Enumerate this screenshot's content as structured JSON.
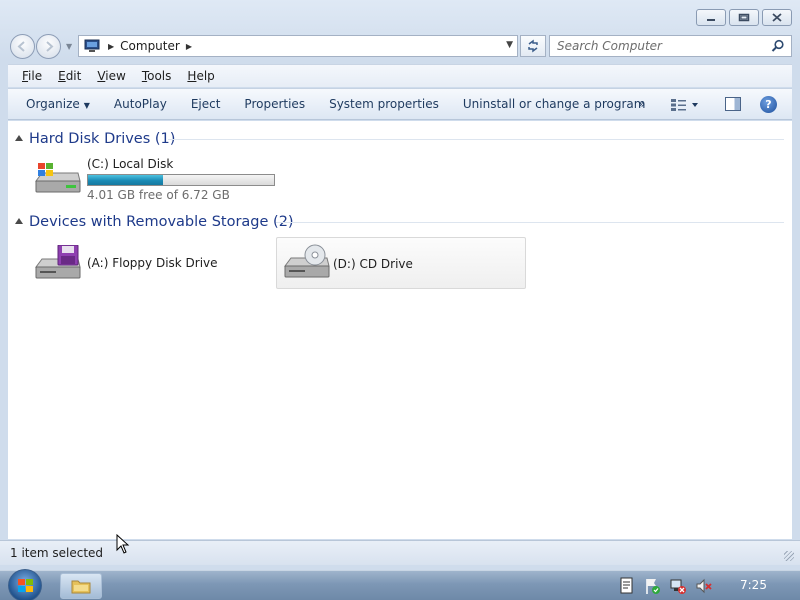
{
  "window": {
    "title_buttons": {
      "minimize_icon": "minimize-icon",
      "maximize_icon": "restore-icon",
      "close_icon": "close-icon"
    }
  },
  "address": {
    "location_icon": "computer-icon",
    "breadcrumb": [
      "Computer"
    ],
    "search_placeholder": "Search Computer"
  },
  "menu": {
    "items": [
      {
        "label": "File",
        "access_key": "F"
      },
      {
        "label": "Edit",
        "access_key": "E"
      },
      {
        "label": "View",
        "access_key": "V"
      },
      {
        "label": "Tools",
        "access_key": "T"
      },
      {
        "label": "Help",
        "access_key": "H"
      }
    ]
  },
  "commands": {
    "organize": "Organize",
    "autoplay": "AutoPlay",
    "eject": "Eject",
    "properties": "Properties",
    "system_properties": "System properties",
    "uninstall": "Uninstall or change a program",
    "more": "»"
  },
  "groups": {
    "hard_disk": {
      "label": "Hard Disk Drives (1)",
      "drives": [
        {
          "name": "(C:) Local Disk",
          "free_text": "4.01 GB free of 6.72 GB",
          "used_fraction": 0.403
        }
      ]
    },
    "removable": {
      "label": "Devices with Removable Storage (2)",
      "drives": [
        {
          "name": "(A:) Floppy Disk Drive"
        },
        {
          "name": "(D:) CD Drive",
          "selected": true
        }
      ]
    }
  },
  "status": {
    "text": "1 item selected"
  },
  "taskbar": {
    "clock": "7:25"
  },
  "colors": {
    "group_header": "#1e3a8a",
    "capacity_fill": "#1b8bb5",
    "taskbar": "#7d97b5"
  }
}
